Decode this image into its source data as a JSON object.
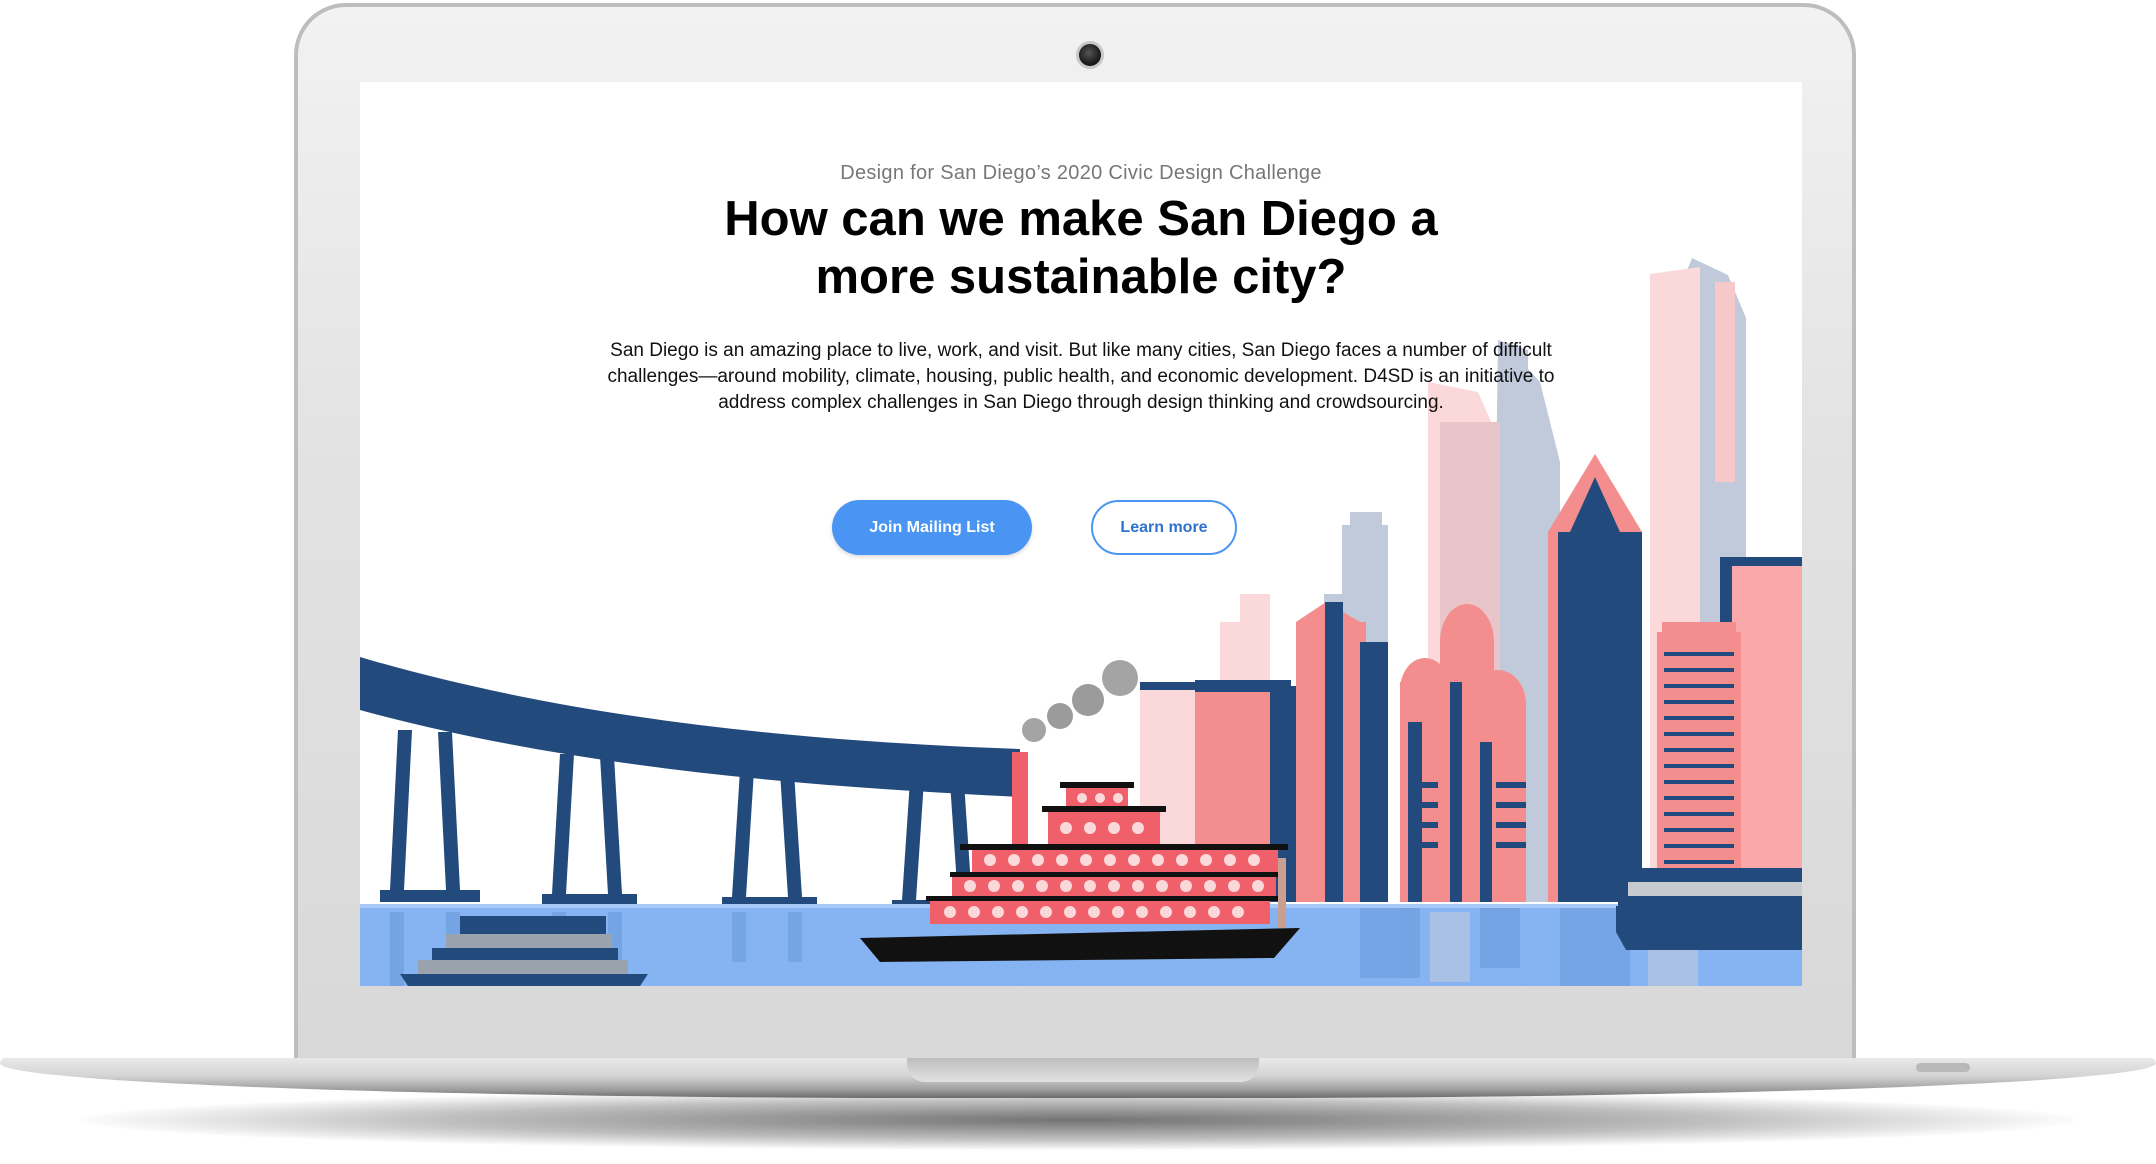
{
  "page": {
    "eyebrow": "Design for San Diego’s 2020 Civic Design Challenge",
    "headline_line1": "How can we make San Diego a",
    "headline_line2": "more sustainable city?",
    "body": "San Diego is an amazing place to live, work, and visit. But like many cities, San Diego faces a number of difficult challenges—around mobility, climate, housing, public health, and economic development.  D4SD is an initiative to address complex challenges in San Diego through design thinking and crowdsourcing.",
    "primary_button": "Join Mailing List",
    "secondary_button": "Learn more"
  },
  "colors": {
    "navy": "#234a7c",
    "salmon": "#f48e8e",
    "pink_light": "#fbd9da",
    "slate": "#c0cadb",
    "water": "#86b3f2",
    "button_blue": "#4a95f4"
  },
  "icons": [
    "camera-icon"
  ]
}
